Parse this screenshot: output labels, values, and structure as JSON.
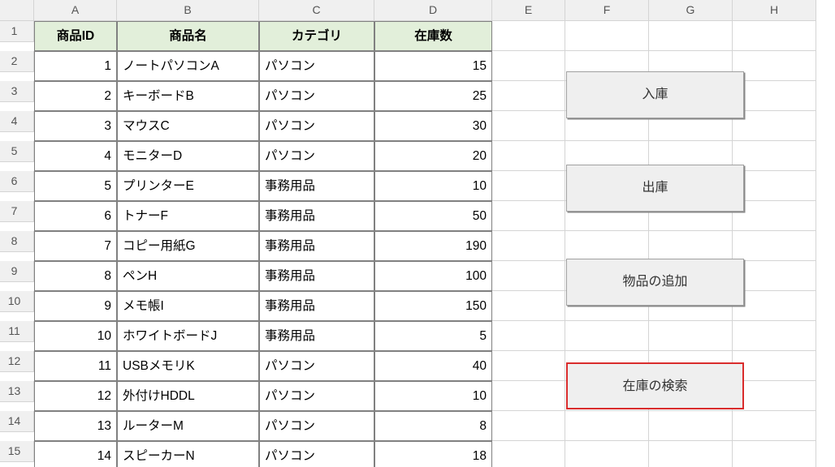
{
  "columns": [
    "A",
    "B",
    "C",
    "D",
    "E",
    "F",
    "G",
    "H"
  ],
  "row_count": 15,
  "headers": {
    "id": "商品ID",
    "name": "商品名",
    "category": "カテゴリ",
    "stock": "在庫数"
  },
  "rows": [
    {
      "id": 1,
      "name": "ノートパソコンA",
      "category": "パソコン",
      "stock": 15
    },
    {
      "id": 2,
      "name": "キーボードB",
      "category": "パソコン",
      "stock": 25
    },
    {
      "id": 3,
      "name": "マウスC",
      "category": "パソコン",
      "stock": 30
    },
    {
      "id": 4,
      "name": "モニターD",
      "category": "パソコン",
      "stock": 20
    },
    {
      "id": 5,
      "name": "プリンターE",
      "category": "事務用品",
      "stock": 10
    },
    {
      "id": 6,
      "name": "トナーF",
      "category": "事務用品",
      "stock": 50
    },
    {
      "id": 7,
      "name": "コピー用紙G",
      "category": "事務用品",
      "stock": 190
    },
    {
      "id": 8,
      "name": "ペンH",
      "category": "事務用品",
      "stock": 100
    },
    {
      "id": 9,
      "name": "メモ帳I",
      "category": "事務用品",
      "stock": 150
    },
    {
      "id": 10,
      "name": "ホワイトボードJ",
      "category": "事務用品",
      "stock": 5
    },
    {
      "id": 11,
      "name": "USBメモリK",
      "category": "パソコン",
      "stock": 40
    },
    {
      "id": 12,
      "name": "外付けHDDL",
      "category": "パソコン",
      "stock": 10
    },
    {
      "id": 13,
      "name": "ルーターM",
      "category": "パソコン",
      "stock": 8
    },
    {
      "id": 14,
      "name": "スピーカーN",
      "category": "パソコン",
      "stock": 18
    }
  ],
  "buttons": {
    "in": "入庫",
    "out": "出庫",
    "add": "物品の追加",
    "search": "在庫の検索"
  }
}
